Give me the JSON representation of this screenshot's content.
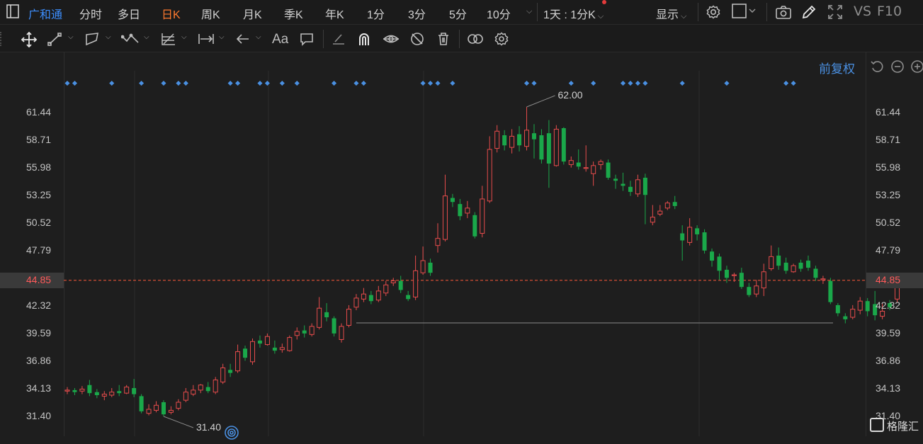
{
  "toolbar": {
    "stock_name": "广和通",
    "periods": [
      "分时",
      "多日",
      "日K",
      "周K",
      "月K",
      "季K",
      "年K",
      "1分",
      "3分",
      "5分",
      "10分"
    ],
    "active_period": "日K",
    "interval_select": "1天 : 1分K",
    "display_label": "显示",
    "vs_label": "VS",
    "f10_label": "F10"
  },
  "drawing_tools": {
    "icons": [
      "move-icon",
      "line-icon",
      "channel-icon",
      "polyline-icon",
      "fib-icon",
      "range-icon",
      "arrow-left-icon",
      "text-tool-icon",
      "comment-icon",
      "eraser-icon",
      "magnet-icon",
      "eye-lock-icon",
      "hide-icon",
      "trash-icon",
      "compare-icon",
      "settings-icon"
    ],
    "text_tool_label": "Aa"
  },
  "adjust": {
    "label": "前复权"
  },
  "chart_data": {
    "type": "candlestick",
    "y_ticks": [
      61.44,
      58.71,
      55.98,
      53.25,
      50.52,
      47.79,
      44.85,
      42.32,
      39.59,
      36.86,
      34.13,
      31.4
    ],
    "ylim": [
      30.9,
      63.5
    ],
    "current_price": 44.85,
    "high_label": "62.00",
    "low_label": "31.40",
    "colors": {
      "up": "#e74c4c",
      "down": "#1aa84a",
      "bg": "#1e1e1e",
      "marker": "#4a90e2",
      "price_line": "#ff5a3a"
    },
    "candles": [
      [
        33.9,
        34.0,
        34.3,
        33.6
      ],
      [
        34.0,
        33.8,
        34.2,
        33.5
      ],
      [
        33.9,
        34.1,
        34.4,
        33.6
      ],
      [
        34.5,
        33.7,
        35.0,
        33.4
      ],
      [
        33.8,
        33.5,
        34.1,
        33.2
      ],
      [
        33.4,
        33.6,
        33.9,
        33.0
      ],
      [
        33.5,
        33.8,
        34.2,
        33.3
      ],
      [
        33.9,
        33.7,
        34.5,
        33.4
      ],
      [
        33.7,
        34.3,
        34.5,
        33.6
      ],
      [
        34.2,
        33.6,
        35.1,
        33.3
      ],
      [
        33.4,
        31.9,
        33.6,
        31.7
      ],
      [
        31.7,
        32.1,
        32.6,
        31.5
      ],
      [
        32.0,
        32.5,
        32.9,
        31.8
      ],
      [
        32.8,
        31.6,
        33.0,
        31.4
      ],
      [
        31.8,
        32.0,
        32.4,
        31.6
      ],
      [
        32.2,
        32.8,
        33.1,
        32.0
      ],
      [
        33.0,
        33.8,
        34.2,
        32.8
      ],
      [
        33.6,
        34.0,
        34.5,
        33.4
      ],
      [
        34.0,
        34.5,
        34.6,
        33.7
      ],
      [
        34.3,
        33.9,
        34.8,
        33.7
      ],
      [
        33.8,
        35.0,
        35.3,
        33.6
      ],
      [
        34.8,
        36.2,
        36.6,
        34.6
      ],
      [
        36.0,
        35.7,
        36.6,
        35.3
      ],
      [
        35.9,
        37.8,
        38.5,
        35.7
      ],
      [
        38.1,
        37.2,
        38.4,
        36.9
      ],
      [
        36.8,
        38.8,
        39.1,
        36.5
      ],
      [
        38.9,
        38.6,
        39.4,
        38.2
      ],
      [
        38.5,
        39.3,
        39.6,
        38.4
      ],
      [
        38.2,
        37.9,
        38.9,
        37.6
      ],
      [
        38.0,
        38.2,
        38.6,
        37.7
      ],
      [
        37.9,
        39.2,
        39.4,
        37.8
      ],
      [
        39.4,
        39.8,
        40.2,
        39.0
      ],
      [
        39.9,
        39.6,
        40.4,
        39.2
      ],
      [
        39.5,
        40.3,
        40.6,
        39.3
      ],
      [
        40.2,
        42.1,
        43.2,
        40.0
      ],
      [
        41.7,
        41.2,
        42.6,
        40.8
      ],
      [
        41.1,
        39.6,
        41.3,
        39.3
      ],
      [
        39.0,
        40.3,
        40.6,
        38.7
      ],
      [
        40.4,
        42.0,
        42.4,
        40.2
      ],
      [
        42.2,
        43.1,
        43.5,
        41.9
      ],
      [
        43.0,
        43.5,
        44.1,
        42.7
      ],
      [
        43.4,
        42.8,
        43.8,
        42.5
      ],
      [
        42.9,
        43.8,
        44.3,
        42.7
      ],
      [
        43.6,
        44.4,
        44.8,
        43.3
      ],
      [
        44.6,
        44.8,
        45.1,
        44.3
      ],
      [
        44.8,
        43.9,
        45.3,
        43.6
      ],
      [
        43.4,
        43.0,
        43.8,
        42.8
      ],
      [
        43.2,
        45.8,
        47.3,
        42.9
      ],
      [
        45.6,
        46.8,
        48.2,
        45.4
      ],
      [
        46.6,
        45.6,
        47.0,
        45.3
      ],
      [
        48.3,
        49.0,
        50.5,
        47.6
      ],
      [
        48.9,
        53.2,
        55.3,
        48.7
      ],
      [
        53.0,
        52.6,
        53.4,
        52.1
      ],
      [
        52.4,
        51.2,
        52.9,
        50.8
      ],
      [
        51.5,
        52.0,
        52.7,
        51.0
      ],
      [
        51.3,
        49.2,
        51.6,
        49.0
      ],
      [
        49.5,
        52.9,
        54.2,
        49.1
      ],
      [
        52.7,
        57.8,
        59.1,
        52.5
      ],
      [
        57.9,
        59.6,
        60.2,
        57.5
      ],
      [
        59.2,
        58.2,
        59.7,
        57.7
      ],
      [
        58.0,
        59.1,
        59.8,
        57.4
      ],
      [
        59.3,
        58.2,
        60.1,
        57.6
      ],
      [
        58.1,
        59.7,
        62.0,
        57.7
      ],
      [
        59.4,
        58.8,
        60.3,
        56.9
      ],
      [
        59.2,
        56.8,
        59.8,
        56.4
      ],
      [
        59.4,
        56.4,
        60.7,
        54.0
      ],
      [
        56.2,
        59.8,
        60.2,
        56.1
      ],
      [
        59.9,
        56.6,
        60.0,
        56.3
      ],
      [
        56.3,
        56.7,
        57.1,
        56.0
      ],
      [
        56.5,
        56.1,
        57.8,
        55.8
      ],
      [
        56.0,
        56.0,
        58.2,
        55.6
      ],
      [
        55.4,
        56.2,
        56.6,
        54.2
      ],
      [
        56.3,
        56.6,
        56.8,
        55.8
      ],
      [
        56.5,
        55.0,
        56.8,
        54.8
      ],
      [
        54.9,
        54.7,
        55.3,
        53.9
      ],
      [
        54.4,
        54.2,
        55.5,
        53.7
      ],
      [
        54.1,
        53.6,
        54.7,
        53.2
      ],
      [
        53.4,
        54.8,
        55.3,
        53.1
      ],
      [
        55.0,
        53.3,
        55.4,
        50.4
      ],
      [
        50.6,
        51.1,
        52.3,
        50.3
      ],
      [
        51.4,
        51.7,
        52.3,
        51.2
      ],
      [
        52.0,
        52.5,
        52.7,
        51.8
      ],
      [
        52.6,
        52.2,
        53.2,
        51.9
      ],
      [
        49.5,
        48.8,
        50.3,
        46.8
      ],
      [
        48.6,
        50.1,
        51.0,
        48.3
      ],
      [
        50.0,
        49.4,
        50.3,
        48.8
      ],
      [
        49.6,
        47.8,
        49.9,
        47.5
      ],
      [
        47.7,
        46.8,
        48.0,
        46.2
      ],
      [
        47.2,
        45.8,
        47.5,
        44.9
      ],
      [
        45.9,
        45.1,
        46.3,
        44.6
      ],
      [
        45.4,
        45.4,
        45.6,
        44.7
      ],
      [
        45.6,
        44.2,
        46.1,
        44.0
      ],
      [
        44.2,
        43.4,
        44.6,
        43.2
      ],
      [
        43.5,
        44.3,
        44.9,
        43.2
      ],
      [
        44.1,
        45.7,
        46.5,
        43.3
      ],
      [
        46.0,
        47.2,
        48.3,
        45.8
      ],
      [
        47.3,
        46.3,
        48.1,
        45.9
      ],
      [
        46.6,
        45.8,
        47.1,
        45.5
      ],
      [
        45.7,
        46.3,
        46.5,
        45.6
      ],
      [
        46.6,
        46.0,
        46.9,
        45.7
      ],
      [
        46.8,
        46.1,
        47.3,
        45.8
      ],
      [
        46.0,
        45.1,
        46.3,
        44.8
      ],
      [
        44.9,
        45.0,
        45.3,
        44.5
      ],
      [
        44.8,
        42.7,
        45.1,
        42.5
      ],
      [
        42.4,
        41.6,
        42.6,
        41.3
      ],
      [
        41.3,
        41.0,
        41.6,
        40.6
      ],
      [
        41.2,
        42.0,
        42.4,
        41.0
      ],
      [
        41.9,
        42.8,
        43.2,
        41.5
      ],
      [
        42.8,
        41.8,
        43.1,
        41.3
      ],
      [
        42.5,
        41.4,
        43.8,
        40.9
      ],
      [
        41.3,
        41.8,
        42.6,
        41.0
      ],
      [
        42.6,
        42.2,
        42.9,
        41.9
      ],
      [
        43.0,
        44.5,
        45.1,
        42.7
      ]
    ],
    "marker_indices": [
      0,
      1,
      6,
      10,
      13,
      15,
      16,
      22,
      23,
      26,
      27,
      29,
      31,
      36,
      39,
      40,
      48,
      49,
      50,
      52,
      62,
      63,
      68,
      71,
      75,
      76,
      77,
      78,
      83,
      89,
      97,
      98
    ]
  },
  "watermark": {
    "text": "格隆汇"
  }
}
